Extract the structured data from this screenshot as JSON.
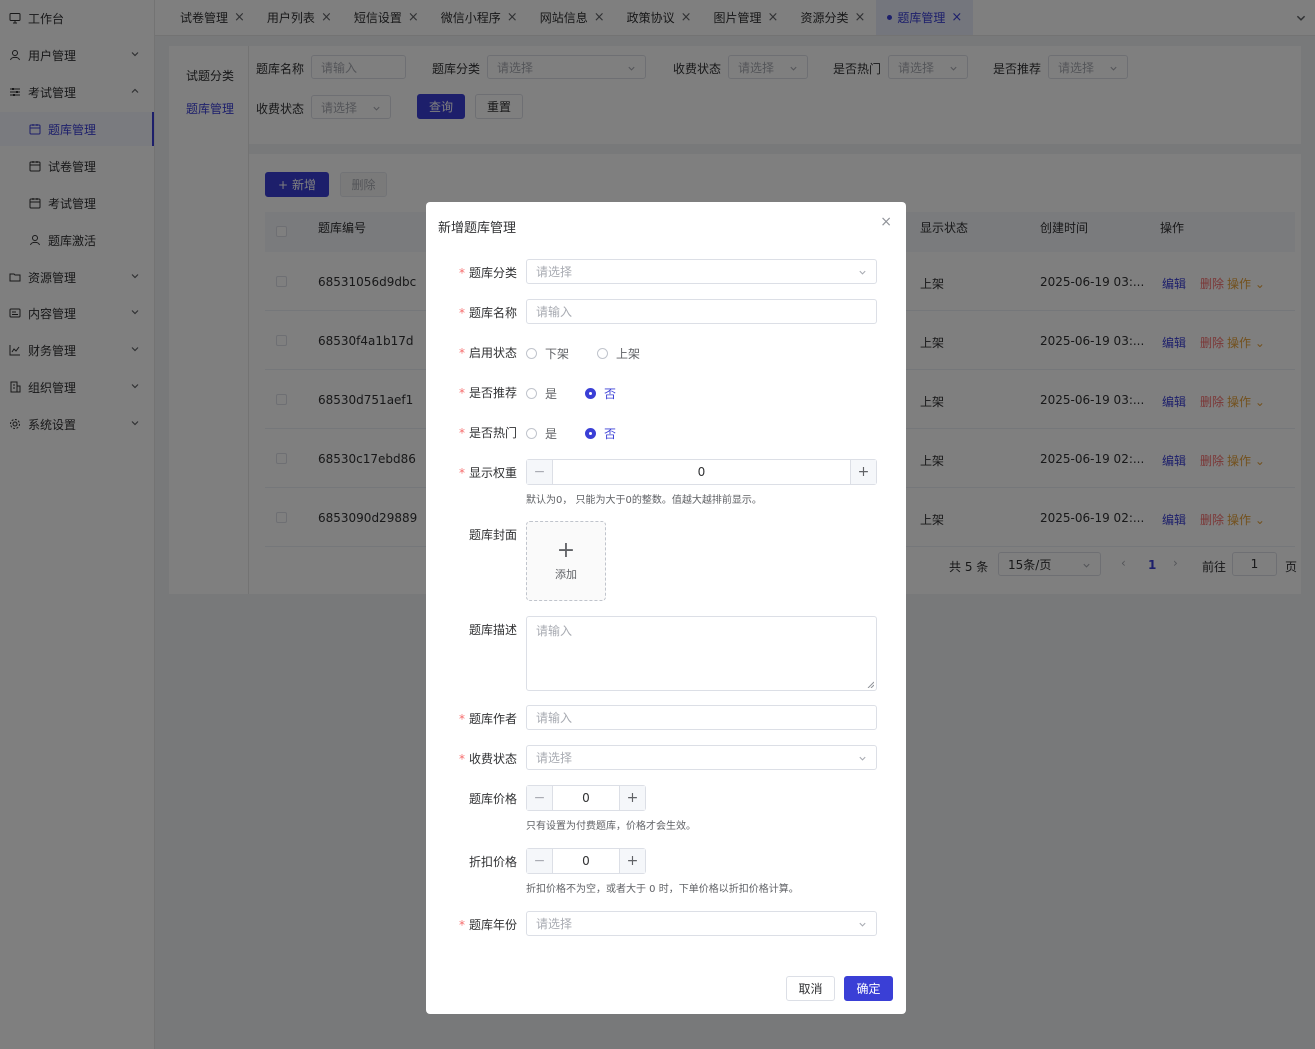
{
  "sidebar": {
    "items": [
      {
        "label": "工作台",
        "icon": "monitor-icon"
      },
      {
        "label": "用户管理",
        "icon": "user-icon"
      },
      {
        "label": "考试管理",
        "icon": "sliders-icon"
      },
      {
        "label": "题库管理",
        "icon": "calendar-icon"
      },
      {
        "label": "试卷管理",
        "icon": "calendar-icon"
      },
      {
        "label": "考试管理",
        "icon": "calendar-icon"
      },
      {
        "label": "题库激活",
        "icon": "user-icon"
      },
      {
        "label": "资源管理",
        "icon": "folder-icon"
      },
      {
        "label": "内容管理",
        "icon": "image-icon"
      },
      {
        "label": "财务管理",
        "icon": "chart-icon"
      },
      {
        "label": "组织管理",
        "icon": "building-icon"
      },
      {
        "label": "系统设置",
        "icon": "gear-icon"
      }
    ]
  },
  "tabs": [
    {
      "label": "试卷管理"
    },
    {
      "label": "用户列表"
    },
    {
      "label": "短信设置"
    },
    {
      "label": "微信小程序"
    },
    {
      "label": "网站信息"
    },
    {
      "label": "政策协议"
    },
    {
      "label": "图片管理"
    },
    {
      "label": "资源分类"
    },
    {
      "label": "题库管理"
    }
  ],
  "categories": [
    "试题分类",
    "题库管理"
  ],
  "filters": {
    "name_label": "题库名称",
    "name_placeholder": "请输入",
    "category_label": "题库分类",
    "category_placeholder": "请选择",
    "fee_label": "收费状态",
    "fee_placeholder": "请选择",
    "hot_label": "是否热门",
    "hot_placeholder": "请选择",
    "recommend_label": "是否推荐",
    "recommend_placeholder": "请选择",
    "fee2_label": "收费状态",
    "fee2_placeholder": "请选择",
    "query_label": "查询",
    "reset_label": "重置"
  },
  "toolbar": {
    "add_label": "新增",
    "delete_label": "删除"
  },
  "table": {
    "headers": {
      "id": "题库编号",
      "display": "显示状态",
      "created": "创建时间",
      "ops": "操作"
    },
    "rows": [
      {
        "id": "68531056d9dbc",
        "display": "上架",
        "created": "2025-06-19 03:..."
      },
      {
        "id": "68530f4a1b17d",
        "display": "上架",
        "created": "2025-06-19 03:..."
      },
      {
        "id": "68530d751aef1",
        "display": "上架",
        "created": "2025-06-19 03:..."
      },
      {
        "id": "68530c17ebd86",
        "display": "上架",
        "created": "2025-06-19 02:..."
      },
      {
        "id": "6853090d29889",
        "display": "上架",
        "created": "2025-06-19 02:..."
      }
    ],
    "edit_label": "编辑",
    "delete_label": "删除",
    "ops_label": "操作"
  },
  "pagination": {
    "total": "共 5 条",
    "page_size": "15条/页",
    "current_page": "1",
    "goto_label": "前往",
    "goto_value": "1",
    "page_suffix": "页"
  },
  "dialog": {
    "title": "新增题库管理",
    "close": "×",
    "category_label": "题库分类",
    "category_placeholder": "请选择",
    "name_label": "题库名称",
    "name_placeholder": "请输入",
    "status_label": "启用状态",
    "status_options": [
      "下架",
      "上架"
    ],
    "recommend_label": "是否推荐",
    "recommend_options": [
      "是",
      "否"
    ],
    "hot_label": "是否热门",
    "hot_options": [
      "是",
      "否"
    ],
    "weight_label": "显示权重",
    "weight_value": "0",
    "weight_hint": "默认为0， 只能为大于0的整数。值越大越排前显示。",
    "cover_label": "题库封面",
    "cover_add": "添加",
    "desc_label": "题库描述",
    "desc_placeholder": "请输入",
    "author_label": "题库作者",
    "author_placeholder": "请输入",
    "fee_label": "收费状态",
    "fee_placeholder": "请选择",
    "price_label": "题库价格",
    "price_value": "0",
    "price_hint": "只有设置为付费题库，价格才会生效。",
    "discount_label": "折扣价格",
    "discount_value": "0",
    "discount_hint": "折扣价格不为空，或者大于 0 时，下单价格以折扣价格计算。",
    "year_label": "题库年份",
    "year_placeholder": "请选择",
    "cancel_label": "取消",
    "confirm_label": "确定"
  },
  "colors": {
    "primary": "#3a3fd6",
    "danger": "#f56c6c",
    "warning": "#e6a23c"
  }
}
